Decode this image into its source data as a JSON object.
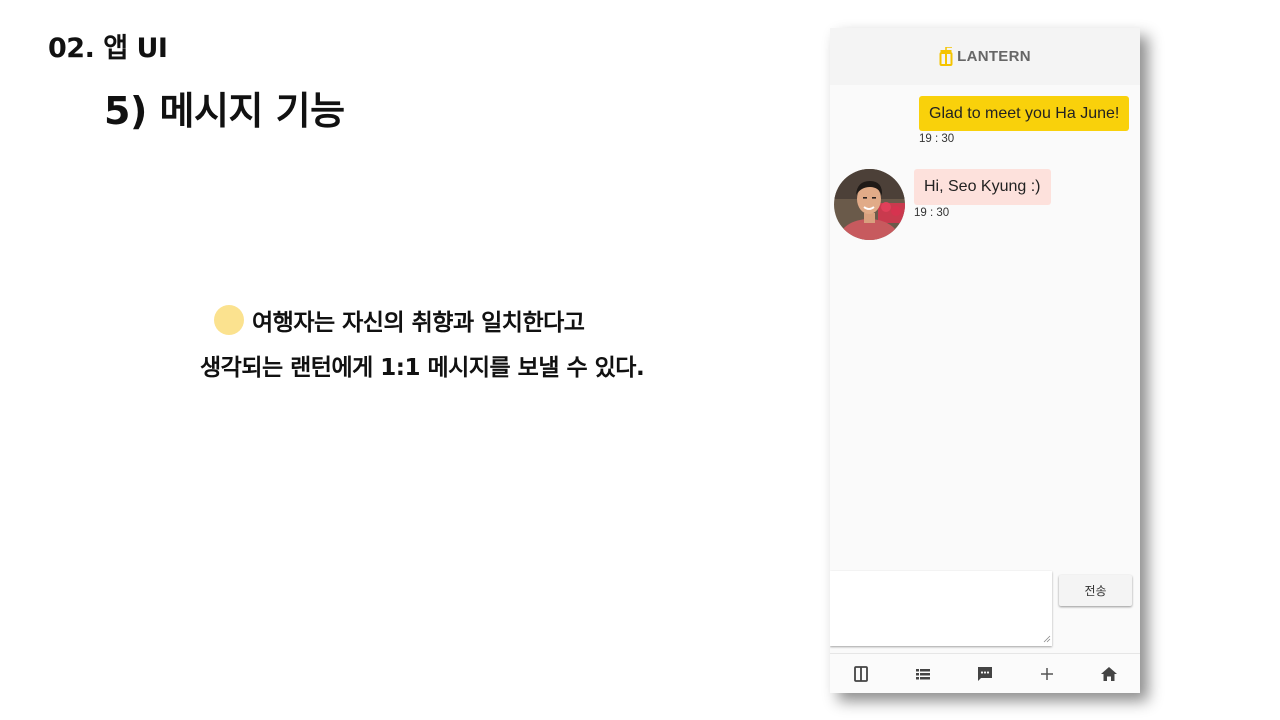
{
  "slide": {
    "section_title": "02. 앱 UI",
    "title": "5) 메시지 기능",
    "description_line1": "여행자는 자신의 취향과 일치한다고",
    "description_line2": "생각되는 랜턴에게 1:1 메시지를 보낼 수 있다.",
    "bullet_color": "#fbe28f"
  },
  "app": {
    "brand": "LANTERN",
    "brand_color": "#f5c400",
    "messages": [
      {
        "direction": "sent",
        "text": "Glad to meet you Ha June!",
        "time": "19 : 30",
        "bubble_color": "#f9d10b"
      },
      {
        "direction": "received",
        "text": "Hi, Seo Kyung :)",
        "time": "19 : 30",
        "bubble_color": "#fde1dc"
      }
    ],
    "composer": {
      "input_value": "",
      "send_label": "전송"
    },
    "nav": [
      {
        "icon": "lantern-guide-icon"
      },
      {
        "icon": "list-icon"
      },
      {
        "icon": "chat-icon"
      },
      {
        "icon": "plus-icon"
      },
      {
        "icon": "home-icon"
      }
    ]
  }
}
